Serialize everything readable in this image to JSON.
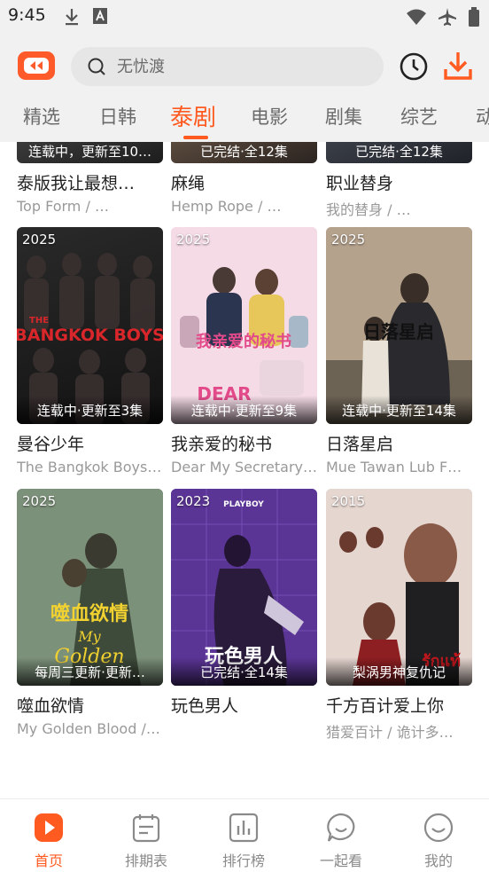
{
  "status_bar": {
    "time": "9:45"
  },
  "search": {
    "placeholder": "无忧渡"
  },
  "tabs": [
    {
      "label": "精选"
    },
    {
      "label": "日韩"
    },
    {
      "label": "泰剧"
    },
    {
      "label": "电影"
    },
    {
      "label": "剧集"
    },
    {
      "label": "综艺"
    },
    {
      "label": "动"
    }
  ],
  "active_tab": "泰剧",
  "partial_row": [
    {
      "status": "连载中，更新至10…",
      "title": "泰版我让最想…",
      "subtitle": "Top Form / …",
      "colors": [
        "#3a3a3a",
        "#1d1d1d"
      ]
    },
    {
      "status": "已完结·全12集",
      "title": "麻绳",
      "subtitle": "Hemp Rope / …",
      "colors": [
        "#5a4a3d",
        "#2b2420"
      ]
    },
    {
      "status": "已完结·全12集",
      "title": "职业替身",
      "subtitle": "我的替身 / …",
      "colors": [
        "#3b3f48",
        "#1f2228"
      ]
    }
  ],
  "rows": [
    [
      {
        "year": "2025",
        "status": "连载中·更新至3集",
        "title": "曼谷少年",
        "subtitle": "The Bangkok Boys…",
        "colors": [
          "#2a2a2a",
          "#121212"
        ],
        "poster_text": "THE BANGKOK BOYS",
        "accent": "#d8262a"
      },
      {
        "year": "2025",
        "status": "连载中·更新至9集",
        "title": "我亲爱的秘书",
        "subtitle": "Dear My Secretary…",
        "colors": [
          "#f3cadb",
          "#f7eef3"
        ],
        "poster_text": "我亲爱的秘书",
        "accent": "#e24a8a"
      },
      {
        "year": "2025",
        "status": "连载中·更新至14集",
        "title": "日落星启",
        "subtitle": "Mue Tawan Lub F…",
        "colors": [
          "#a9937d",
          "#5f5446"
        ],
        "poster_text": "日落星启",
        "accent": "#ffffff"
      }
    ],
    [
      {
        "year": "2025",
        "status": "每周三更新·更新…",
        "title": "噬血欲情",
        "subtitle": "My Golden Blood /…",
        "colors": [
          "#6f8a6e",
          "#2f3a2c"
        ],
        "poster_text": "噬血欲情",
        "accent": "#f2d230"
      },
      {
        "year": "2023",
        "status": "已完结·全14集",
        "title": "玩色男人",
        "subtitle": "",
        "colors": [
          "#6b3fa8",
          "#2a1650"
        ],
        "poster_text": "玩色男人",
        "accent": "#ffffff"
      },
      {
        "year": "2015",
        "status": "梨涡男神复仇记",
        "title": "千方百计爱上你",
        "subtitle": "猎爱百计 / 诡计多…",
        "colors": [
          "#d9c7c2",
          "#6c2a2a"
        ],
        "poster_text": "",
        "accent": "#c4161c"
      }
    ]
  ],
  "bottom_nav": [
    {
      "label": "首页",
      "icon": "play-icon",
      "active": true
    },
    {
      "label": "排期表",
      "icon": "calendar-icon",
      "active": false
    },
    {
      "label": "排行榜",
      "icon": "chart-icon",
      "active": false
    },
    {
      "label": "一起看",
      "icon": "chat-icon",
      "active": false
    },
    {
      "label": "我的",
      "icon": "smile-icon",
      "active": false
    }
  ],
  "colors": {
    "accent": "#ff5a1f",
    "background": "#f1f1f1"
  }
}
